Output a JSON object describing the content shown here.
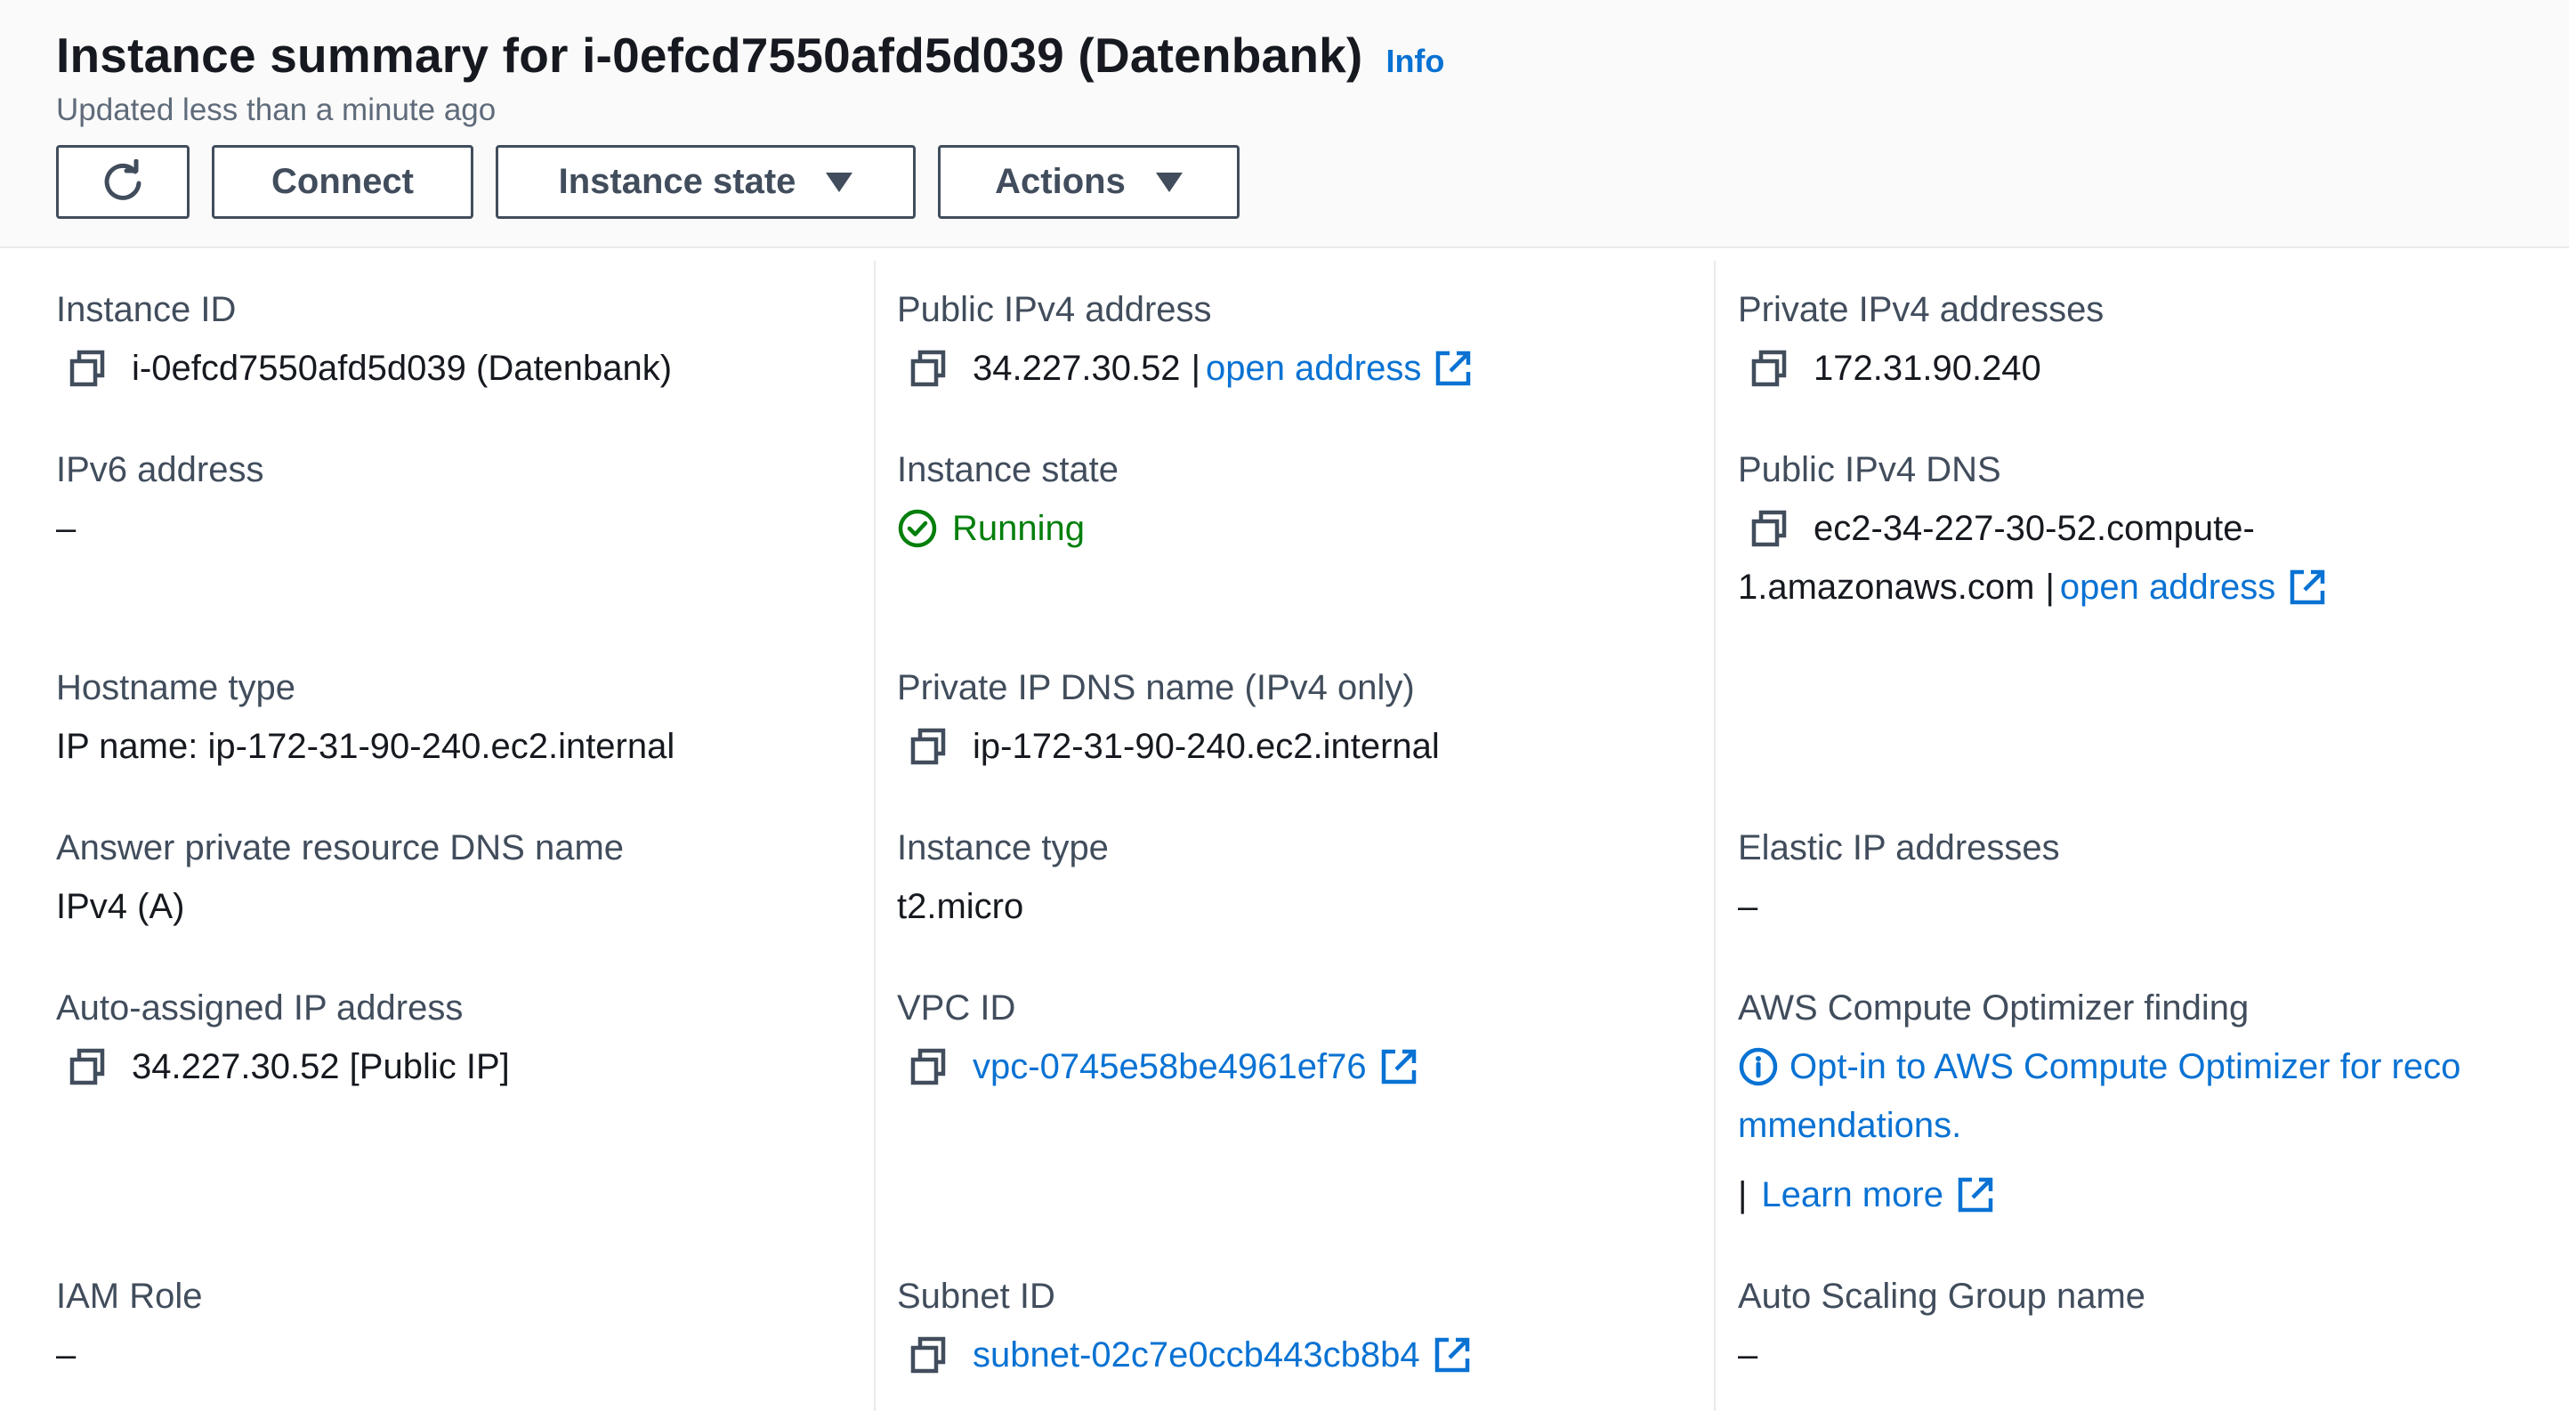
{
  "header": {
    "title": "Instance summary for i-0efcd7550afd5d039 (Datenbank)",
    "info_label": "Info",
    "subtitle": "Updated less than a minute ago",
    "buttons": {
      "connect": "Connect",
      "instance_state": "Instance state",
      "actions": "Actions"
    }
  },
  "fields": {
    "instance_id": {
      "label": "Instance ID",
      "value": "i-0efcd7550afd5d039 (Datenbank)"
    },
    "public_ipv4": {
      "label": "Public IPv4 address",
      "value": "34.227.30.52",
      "separator": "|",
      "link": "open address"
    },
    "private_ipv4": {
      "label": "Private IPv4 addresses",
      "value": "172.31.90.240"
    },
    "ipv6": {
      "label": "IPv6 address",
      "value": "–"
    },
    "instance_state": {
      "label": "Instance state",
      "value": "Running"
    },
    "public_dns": {
      "label": "Public IPv4 DNS",
      "value_line1": "ec2-34-227-30-52.compute-",
      "value_line2": "1.amazonaws.com",
      "separator": "|",
      "link": "open address"
    },
    "hostname_type": {
      "label": "Hostname type",
      "value": "IP name: ip-172-31-90-240.ec2.internal"
    },
    "private_dns": {
      "label": "Private IP DNS name (IPv4 only)",
      "value": "ip-172-31-90-240.ec2.internal"
    },
    "answer_dns": {
      "label": "Answer private resource DNS name",
      "value": "IPv4 (A)"
    },
    "instance_type": {
      "label": "Instance type",
      "value": "t2.micro"
    },
    "elastic_ip": {
      "label": "Elastic IP addresses",
      "value": "–"
    },
    "auto_ip": {
      "label": "Auto-assigned IP address",
      "value": "34.227.30.52 [Public IP]"
    },
    "vpc_id": {
      "label": "VPC ID",
      "value": "vpc-0745e58be4961ef76"
    },
    "optimizer": {
      "label": "AWS Compute Optimizer finding",
      "link_line1": "Opt-in to AWS Compute Optimizer for reco",
      "link_line2": "mmendations.",
      "separator": "|",
      "learn_more": "Learn more"
    },
    "iam_role": {
      "label": "IAM Role",
      "value": "–"
    },
    "subnet_id": {
      "label": "Subnet ID",
      "value": "subnet-02c7e0ccb443cb8b4"
    },
    "asg_name": {
      "label": "Auto Scaling Group name",
      "value": "–"
    }
  },
  "colors": {
    "link": "#0972d3",
    "running": "#037f0c",
    "label": "#414d5c",
    "text": "#16191f"
  },
  "icons": [
    "refresh-icon",
    "caret-down-icon",
    "copy-icon",
    "external-link-icon",
    "status-running-icon",
    "info-circle-icon"
  ]
}
